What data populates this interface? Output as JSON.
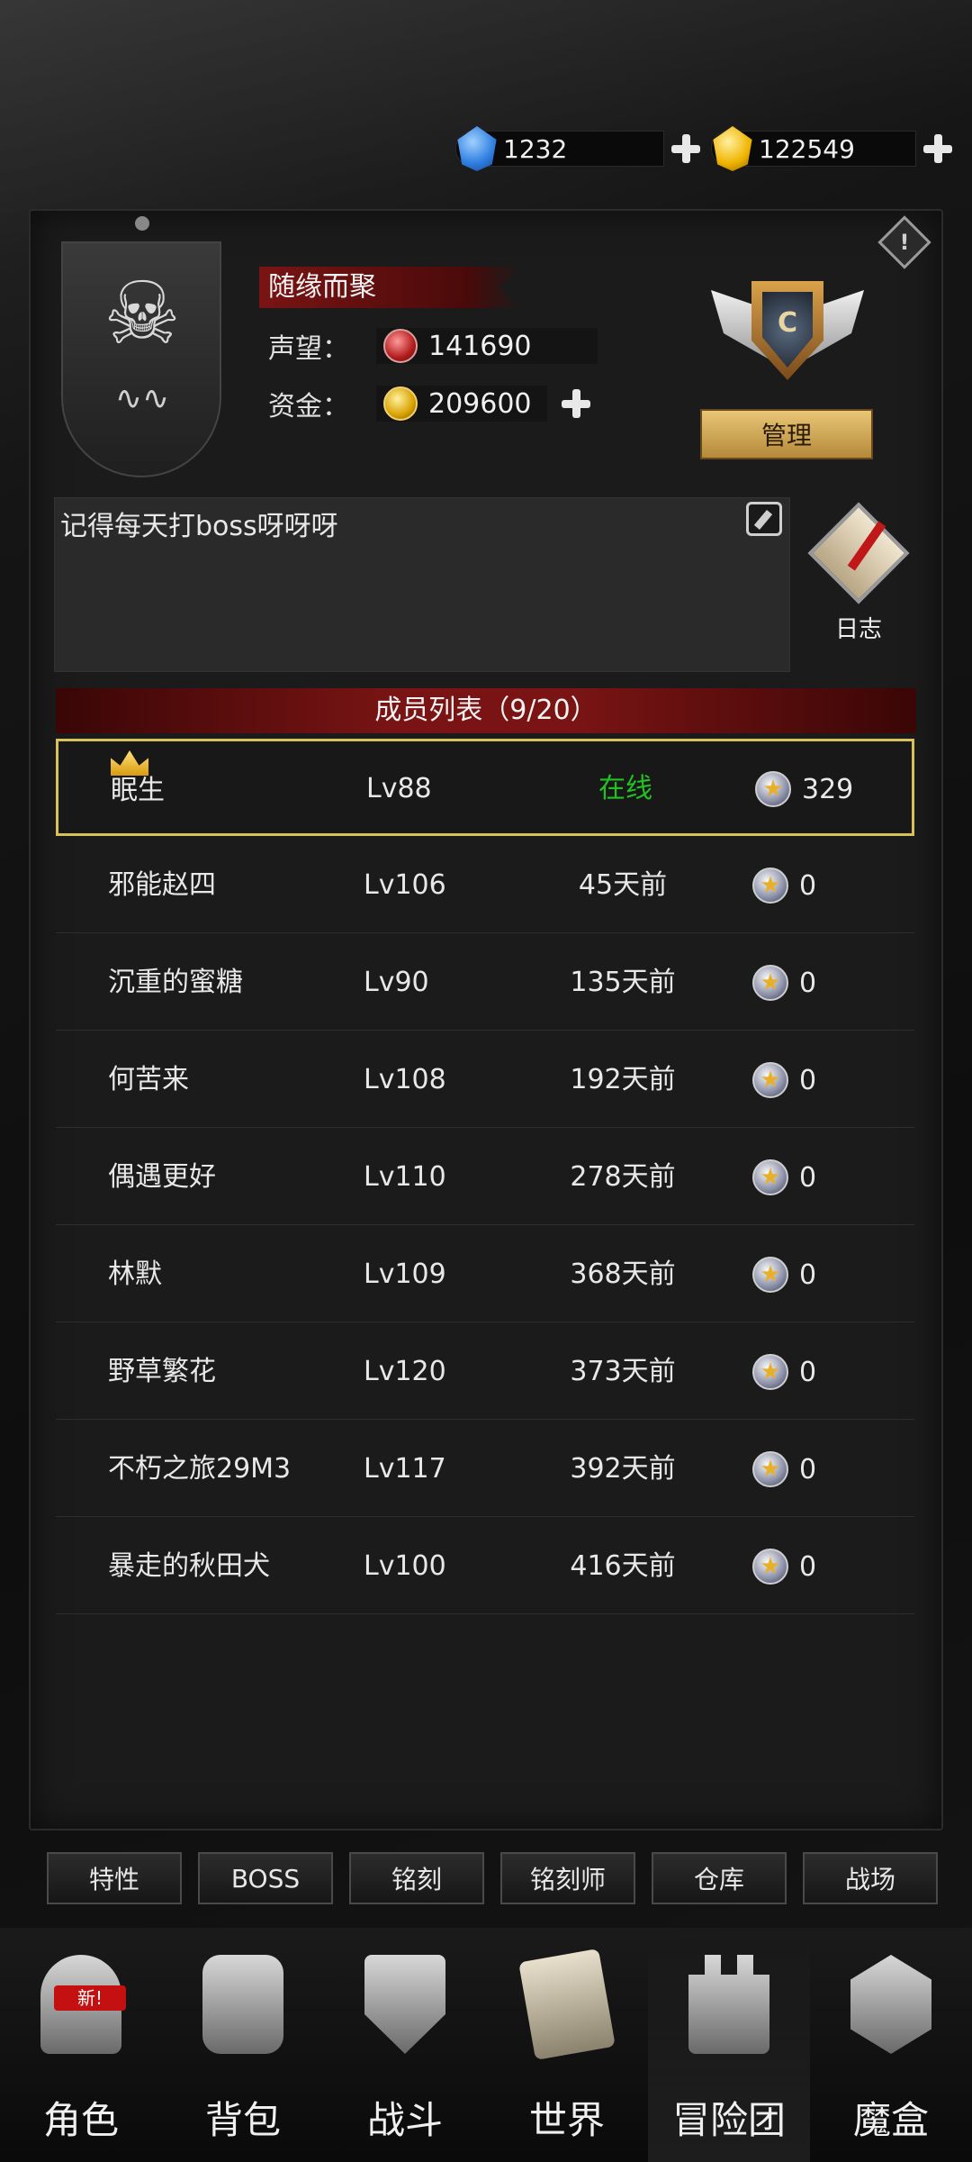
{
  "currencies": {
    "gems": "1232",
    "gold": "122549"
  },
  "guild": {
    "name": "随缘而聚",
    "reputation_label": "声望：",
    "reputation_value": "141690",
    "funds_label": "资金：",
    "funds_value": "209600",
    "rank_letter": "C",
    "manage_label": "管理",
    "notice_text": "记得每天打boss呀呀呀",
    "log_label": "日志"
  },
  "members": {
    "header": "成员列表（9/20）",
    "rows": [
      {
        "name": "眠生",
        "level": "Lv88",
        "status": "在线",
        "contribution": "329"
      },
      {
        "name": "邪能赵四",
        "level": "Lv106",
        "status": "45天前",
        "contribution": "0"
      },
      {
        "name": "沉重的蜜糖",
        "level": "Lv90",
        "status": "135天前",
        "contribution": "0"
      },
      {
        "name": "何苦来",
        "level": "Lv108",
        "status": "192天前",
        "contribution": "0"
      },
      {
        "name": "偶遇更好",
        "level": "Lv110",
        "status": "278天前",
        "contribution": "0"
      },
      {
        "name": "林默",
        "level": "Lv109",
        "status": "368天前",
        "contribution": "0"
      },
      {
        "name": "野草繁花",
        "level": "Lv120",
        "status": "373天前",
        "contribution": "0"
      },
      {
        "name": "不朽之旅29M3",
        "level": "Lv117",
        "status": "392天前",
        "contribution": "0"
      },
      {
        "name": "暴走的秋田犬",
        "level": "Lv100",
        "status": "416天前",
        "contribution": "0"
      }
    ]
  },
  "subtabs": [
    "特性",
    "BOSS",
    "铭刻",
    "铭刻师",
    "仓库",
    "战场"
  ],
  "nav": {
    "new_badge": "新!",
    "items": [
      {
        "label": "角色",
        "icon": "helmet-icon"
      },
      {
        "label": "背包",
        "icon": "backpack-icon"
      },
      {
        "label": "战斗",
        "icon": "sword-shield-icon"
      },
      {
        "label": "世界",
        "icon": "map-icon"
      },
      {
        "label": "冒险团",
        "icon": "castle-icon"
      },
      {
        "label": "魔盒",
        "icon": "cube-icon"
      }
    ]
  },
  "colors": {
    "online": "#22c122",
    "header_red": "#7a1414",
    "self_border": "#d9c15a"
  }
}
